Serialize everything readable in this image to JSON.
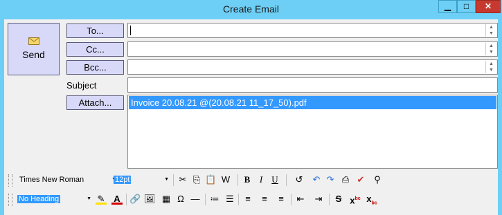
{
  "window": {
    "title": "Create Email",
    "min": "▁",
    "max": "□",
    "close": "✕"
  },
  "send": {
    "label": "Send"
  },
  "fields": {
    "to_label": "To...",
    "cc_label": "Cc...",
    "bcc_label": "Bcc...",
    "subject_label": "Subject",
    "attach_label": "Attach..."
  },
  "attachments": [
    "Invoice 20.08.21 @(20.08.21 11_17_50).pdf"
  ],
  "toolbar": {
    "font_family": "Times New Roman",
    "font_size": "12pt",
    "paragraph_style": "No Heading"
  },
  "colors": {
    "accent": "#6dcff6",
    "selection": "#3399ff",
    "button": "#d8d8f8"
  }
}
